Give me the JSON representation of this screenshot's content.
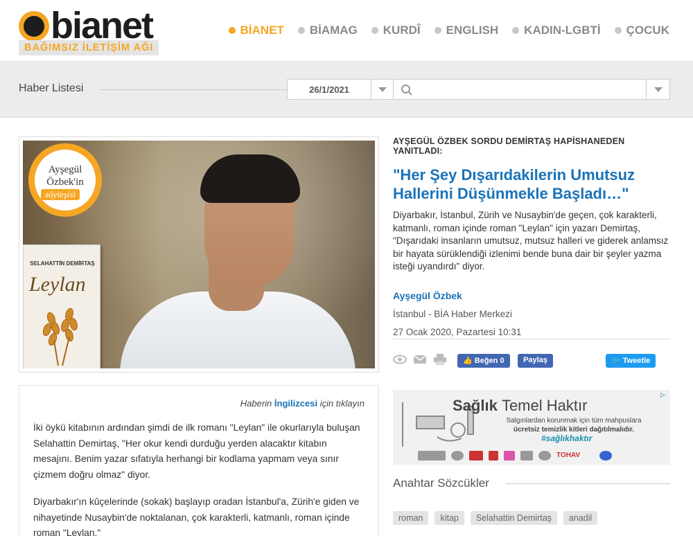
{
  "header": {
    "logo_word": "bianet",
    "logo_tagline": "BAĞIMSIZ İLETİŞİM AĞI",
    "nav": [
      {
        "label": "BİANET",
        "active": true
      },
      {
        "label": "BİAMAG",
        "active": false
      },
      {
        "label": "KURDÎ",
        "active": false
      },
      {
        "label": "ENGLISH",
        "active": false
      },
      {
        "label": "KADIN-LGBTİ",
        "active": false
      },
      {
        "label": "ÇOCUK",
        "active": false
      }
    ]
  },
  "filter": {
    "title": "Haber Listesi",
    "date_value": "26/1/2021",
    "search_placeholder": ""
  },
  "hero": {
    "badge_line1": "Ayşegül",
    "badge_line2": "Özbek'in",
    "badge_line3": "söyleşisi",
    "book_author": "SELAHATTİN DEMİRTAŞ",
    "book_title": "Leylan"
  },
  "article": {
    "kicker": "AYŞEGÜL ÖZBEK SORDU DEMİRTAŞ HAPİSHANEDEN YANITLADI:",
    "headline": "\"Her Şey Dışarıdakilerin Umutsuz Hallerini Düşünmekle Başladı…\"",
    "summary": "Diyarbakır, İstanbul, Zürih ve Nusaybin'de geçen, çok karakterli, katmanlı, roman içinde roman \"Leylan\" için yazarı Demirtaş, \"Dışarıdaki insanların umutsuz, mutsuz halleri ve giderek anlamsız bir hayata sürüklendiği izlenimi bende buna dair bir şeyler yazma isteği uyandırdı\" diyor.",
    "author": "Ayşegül Özbek",
    "place": "İstanbul - BİA Haber Merkezi",
    "date": "27 Ocak 2020, Pazartesi 10:31",
    "english_prefix": "Haberin",
    "english_link": "İngilizcesi",
    "english_suffix": "için tıklayın",
    "paragraphs": [
      "İki öykü kitabının ardından şimdi de ilk romanı \"Leylan\" ile okurlarıyla buluşan Selahattin Demirtaş, \"Her okur kendi durduğu yerden alacaktır kitabın mesajını. Benim yazar sıfatıyla herhangi bir kodlama yapmam veya sınır çizmem doğru olmaz\" diyor.",
      "Diyarbakır'ın kûçelerinde (sokak) başlayıp oradan İstanbul'a, Zürih'e giden ve nihayetinde Nusaybin'de noktalanan, çok karakterli, katmanlı, roman içinde roman \"Leylan.\""
    ]
  },
  "share": {
    "like_label": "Beğen 0",
    "share_label": "Paylaş",
    "tweet_label": "Tweetle"
  },
  "ad": {
    "title_bold": "Sağlık",
    "title_rest": "Temel Haktır",
    "line1": "Salgınlardan korunmak için tüm mahpuslara",
    "line2": "ücretsiz temizlik kitleri dağıtılmalıdır.",
    "hashtag": "#sağlıkhaktır",
    "sponsor_text": "TOHAV"
  },
  "keywords": {
    "title": "Anahtar Sözcükler",
    "tags": [
      "roman",
      "kitap",
      "Selahattin Demirtaş",
      "anadil"
    ]
  },
  "colors": {
    "brand_orange": "#f5a623",
    "link_blue": "#1a73b8",
    "facebook": "#4267b2",
    "twitter": "#1d9bf0"
  }
}
